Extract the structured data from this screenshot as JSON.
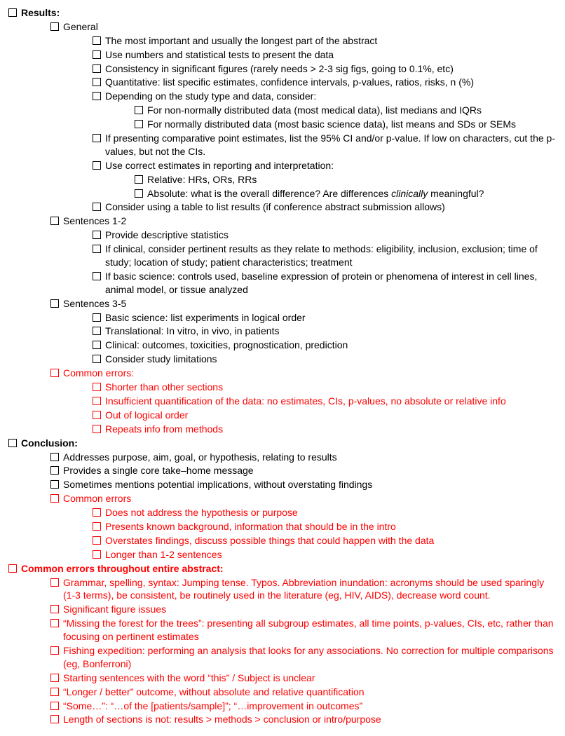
{
  "items": [
    {
      "ind": 0,
      "bold": true,
      "red": false,
      "text": "Results:"
    },
    {
      "ind": 1,
      "bold": false,
      "red": false,
      "text": "General"
    },
    {
      "ind": 2,
      "bold": false,
      "red": false,
      "text": "The most important and usually the longest part of the abstract"
    },
    {
      "ind": 2,
      "bold": false,
      "red": false,
      "text": "Use numbers and statistical tests to present the data"
    },
    {
      "ind": 2,
      "bold": false,
      "red": false,
      "text": "Consistency in significant figures (rarely needs > 2-3 sig figs, going to 0.1%, etc)"
    },
    {
      "ind": 2,
      "bold": false,
      "red": false,
      "text": "Quantitative: list specific estimates, confidence intervals, p-values, ratios, risks, n (%)"
    },
    {
      "ind": 2,
      "bold": false,
      "red": false,
      "text": "Depending on the study type and data, consider:"
    },
    {
      "ind": 3,
      "bold": false,
      "red": false,
      "text": "For non-normally distributed data (most medical data), list medians and IQRs"
    },
    {
      "ind": 3,
      "bold": false,
      "red": false,
      "text": "For normally distributed data (most basic science data), list means and SDs or SEMs"
    },
    {
      "ind": 2,
      "bold": false,
      "red": false,
      "text": "If presenting comparative point estimates, list the 95% CI and/or p-value. If low on characters, cut the p-values, but not the CIs."
    },
    {
      "ind": 2,
      "bold": false,
      "red": false,
      "text": "Use correct estimates in reporting and interpretation:"
    },
    {
      "ind": 3,
      "bold": false,
      "red": false,
      "text": "Relative: HRs, ORs, RRs"
    },
    {
      "ind": 3,
      "bold": false,
      "red": false,
      "html": "Absolute: what is the overall difference? Are differences <span class=\"italic\">clinically</span> meaningful?"
    },
    {
      "ind": 2,
      "bold": false,
      "red": false,
      "text": "Consider using a table to list results (if conference abstract submission allows)"
    },
    {
      "ind": 1,
      "bold": false,
      "red": false,
      "text": "Sentences 1-2"
    },
    {
      "ind": 2,
      "bold": false,
      "red": false,
      "text": "Provide descriptive statistics"
    },
    {
      "ind": 2,
      "bold": false,
      "red": false,
      "text": "If clinical, consider pertinent results as they relate to methods: eligibility, inclusion, exclusion; time of study; location of study; patient characteristics; treatment"
    },
    {
      "ind": 2,
      "bold": false,
      "red": false,
      "text": "If basic science: controls used, baseline expression of protein or phenomena of interest in cell lines, animal model, or tissue analyzed"
    },
    {
      "ind": 1,
      "bold": false,
      "red": false,
      "text": "Sentences 3-5"
    },
    {
      "ind": 2,
      "bold": false,
      "red": false,
      "text": "Basic science: list experiments in logical order"
    },
    {
      "ind": 2,
      "bold": false,
      "red": false,
      "text": "Translational: In vitro, in vivo, in patients"
    },
    {
      "ind": 2,
      "bold": false,
      "red": false,
      "text": "Clinical: outcomes, toxicities, prognostication, prediction"
    },
    {
      "ind": 2,
      "bold": false,
      "red": false,
      "text": "Consider study limitations"
    },
    {
      "ind": 1,
      "bold": false,
      "red": true,
      "text": "Common errors:"
    },
    {
      "ind": 2,
      "bold": false,
      "red": true,
      "text": "Shorter than other sections"
    },
    {
      "ind": 2,
      "bold": false,
      "red": true,
      "text": "Insufficient quantification of the data: no estimates, CIs, p-values, no absolute or relative info"
    },
    {
      "ind": 2,
      "bold": false,
      "red": true,
      "text": "Out of logical order"
    },
    {
      "ind": 2,
      "bold": false,
      "red": true,
      "text": "Repeats info from methods"
    },
    {
      "ind": 0,
      "bold": true,
      "red": false,
      "text": "Conclusion:"
    },
    {
      "ind": 1,
      "bold": false,
      "red": false,
      "text": "Addresses purpose, aim, goal, or hypothesis, relating to results"
    },
    {
      "ind": 1,
      "bold": false,
      "red": false,
      "text": "Provides a single core take–home message"
    },
    {
      "ind": 1,
      "bold": false,
      "red": false,
      "text": "Sometimes mentions potential implications, without overstating findings"
    },
    {
      "ind": 1,
      "bold": false,
      "red": true,
      "text": "Common errors"
    },
    {
      "ind": 2,
      "bold": false,
      "red": true,
      "text": "Does not address the hypothesis or purpose"
    },
    {
      "ind": 2,
      "bold": false,
      "red": true,
      "text": "Presents known background, information that should be in the intro"
    },
    {
      "ind": 2,
      "bold": false,
      "red": true,
      "text": "Overstates findings, discuss possible things that could happen with the data"
    },
    {
      "ind": 2,
      "bold": false,
      "red": true,
      "text": "Longer than 1-2 sentences"
    },
    {
      "ind": 0,
      "bold": true,
      "red": true,
      "text": "Common errors throughout entire abstract:"
    },
    {
      "ind": 1,
      "bold": false,
      "red": true,
      "text": "Grammar, spelling, syntax: Jumping tense. Typos. Abbreviation inundation: acronyms should be used sparingly (1-3 terms), be consistent, be routinely used in the literature (eg, HIV, AIDS), decrease word count."
    },
    {
      "ind": 1,
      "bold": false,
      "red": true,
      "text": "Significant figure issues"
    },
    {
      "ind": 1,
      "bold": false,
      "red": true,
      "text": "“Missing the forest for the trees”: presenting all subgroup estimates, all time points, p-values, CIs, etc, rather than focusing on pertinent estimates"
    },
    {
      "ind": 1,
      "bold": false,
      "red": true,
      "text": "Fishing expedition: performing an analysis that looks for any associations. No correction for multiple comparisons (eg, Bonferroni)"
    },
    {
      "ind": 1,
      "bold": false,
      "red": true,
      "text": "Starting sentences with the word “this” / Subject is unclear"
    },
    {
      "ind": 1,
      "bold": false,
      "red": true,
      "text": "“Longer / better” outcome, without absolute and relative quantification"
    },
    {
      "ind": 1,
      "bold": false,
      "red": true,
      "text": "“Some…”: “…of the [patients/sample]”; “…improvement in outcomes”"
    },
    {
      "ind": 1,
      "bold": false,
      "red": true,
      "text": "Length of sections is not:  results > methods > conclusion or intro/purpose"
    }
  ]
}
